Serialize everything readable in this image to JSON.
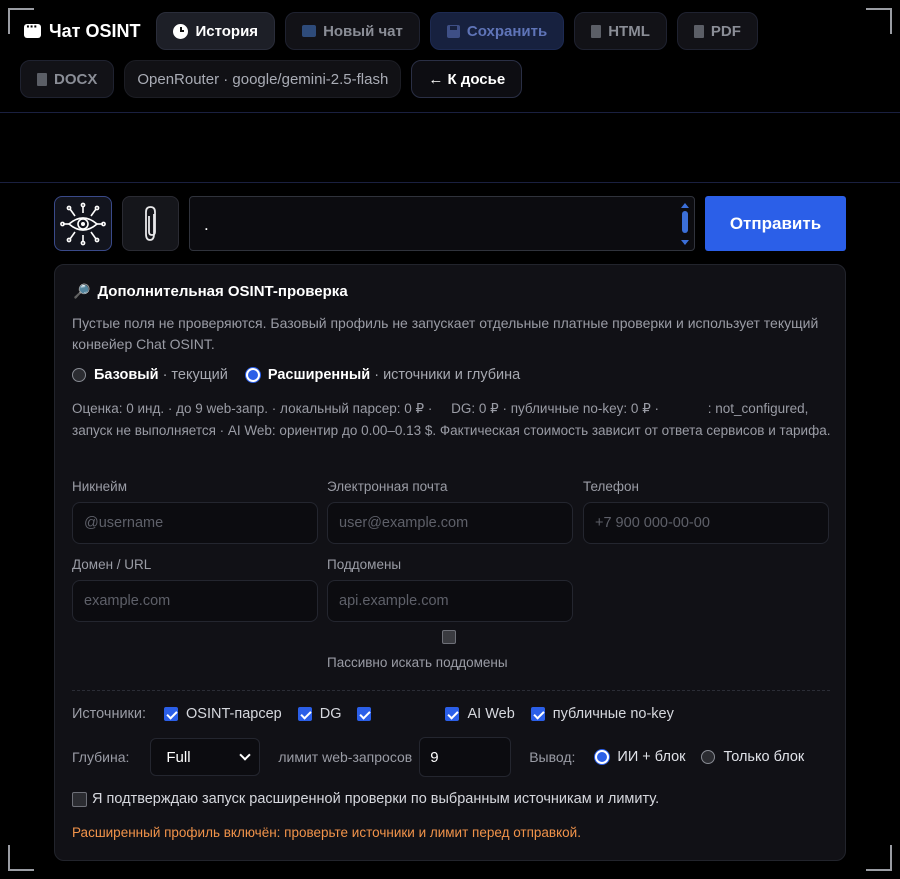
{
  "header": {
    "title": "Чат OSINT",
    "buttons": {
      "history": "История",
      "new_chat": "Новый чат",
      "save": "Сохранить",
      "html": "HTML",
      "pdf": "PDF",
      "docx": "DOCX"
    },
    "model": "OpenRouter · google/gemini-2.5-flash",
    "back": "← К досье"
  },
  "composer": {
    "message": ".",
    "send": "Отправить"
  },
  "panel": {
    "title": "Дополнительная OSINT-проверка",
    "description": "Пустые поля не проверяются. Базовый профиль не запускает отдельные платные проверки и использует текущий конвейер Chat OSINT.",
    "profiles": {
      "basic": {
        "name": "Базовый",
        "hint": "· текущий",
        "selected": false
      },
      "extended": {
        "name": "Расширенный",
        "hint": "· источники и глубина",
        "selected": true
      }
    },
    "estimate": "Оценка: 0 инд. · до 9 web-запр. · локальный парсер: 0 ₽ ·     DG: 0 ₽ · публичные no-key: 0 ₽ ·             : not_configured, запуск не выполняется · AI Web: ориентир до 0.00–0.13 $. Фактическая стоимость зависит от ответа сервисов и тарифа.",
    "fields": {
      "nickname": {
        "label": "Никнейм",
        "placeholder": "@username"
      },
      "email": {
        "label": "Электронная почта",
        "placeholder": "user@example.com"
      },
      "phone": {
        "label": "Телефон",
        "placeholder": "+7 900 000-00-00"
      },
      "domain": {
        "label": "Домен / URL",
        "placeholder": "example.com"
      },
      "subdomains": {
        "label": "Поддомены",
        "placeholder": "api.example.com"
      }
    },
    "passive_subdomains": {
      "label": "Пассивно искать поддомены",
      "checked": false
    },
    "sources": {
      "label": "Источники:",
      "items": [
        {
          "label": "OSINT-парсер",
          "checked": true
        },
        {
          "label": "DG",
          "checked": true
        },
        {
          "label": "",
          "checked": true
        },
        {
          "label": "AI Web",
          "checked": true
        },
        {
          "label": "публичные no-key",
          "checked": true
        }
      ]
    },
    "depth": {
      "label": "Глубина:",
      "value": "Full",
      "limit_label": "лимит web-запросов",
      "limit_value": "9"
    },
    "output": {
      "label": "Вывод:",
      "ai_block": "ИИ + блок",
      "block_only": "Только блок",
      "selected": "ai_block"
    },
    "confirm": "Я подтверждаю запуск расширенной проверки по выбранным источникам и лимиту.",
    "warning": "Расширенный профиль включён: проверьте источники и лимит перед отправкой."
  },
  "colors": {
    "accent": "#2b5fe8",
    "warning": "#f1934a",
    "background": "#000000",
    "panel": "#111116"
  }
}
